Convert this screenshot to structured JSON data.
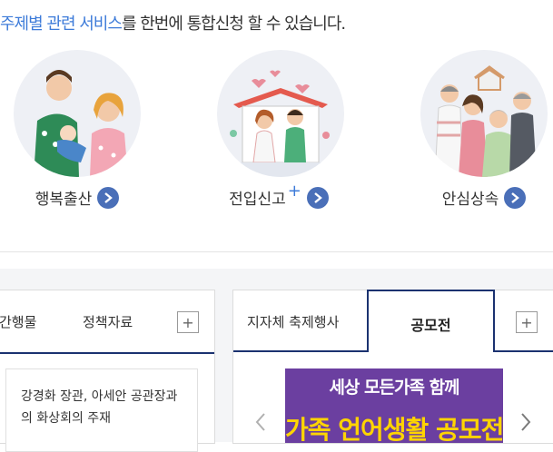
{
  "headline": {
    "highlight": "주제별 관련 서비스",
    "rest": "를 한번에 통합신청 할 수 있습니다."
  },
  "services": [
    {
      "label": "행복출산",
      "arrow_icon": "chevron-right-icon"
    },
    {
      "label": "전입신고",
      "suffix": "+",
      "arrow_icon": "chevron-right-icon"
    },
    {
      "label": "안심상속",
      "arrow_icon": "chevron-right-icon"
    }
  ],
  "left_panel": {
    "tabs": [
      "간행물",
      "정책자료"
    ],
    "plus": "+",
    "article": "강경화 장관, 아세안 공관장과의 화상회의 주재"
  },
  "right_panel": {
    "tabs": [
      "지자체 축제행사",
      "공모전"
    ],
    "active_tab": "공모전",
    "plus": "+",
    "banner_line1": "세상 모든가족 함께",
    "banner_line2": "가족 언어생활 공모전",
    "prev_icon": "chevron-left-icon",
    "next_icon": "chevron-right-icon"
  },
  "colors": {
    "accent": "#3d7bd9",
    "navy": "#1b3270",
    "button": "#4a6fb8",
    "banner": "#6b3fa0",
    "banner_text": "#ffd400"
  }
}
